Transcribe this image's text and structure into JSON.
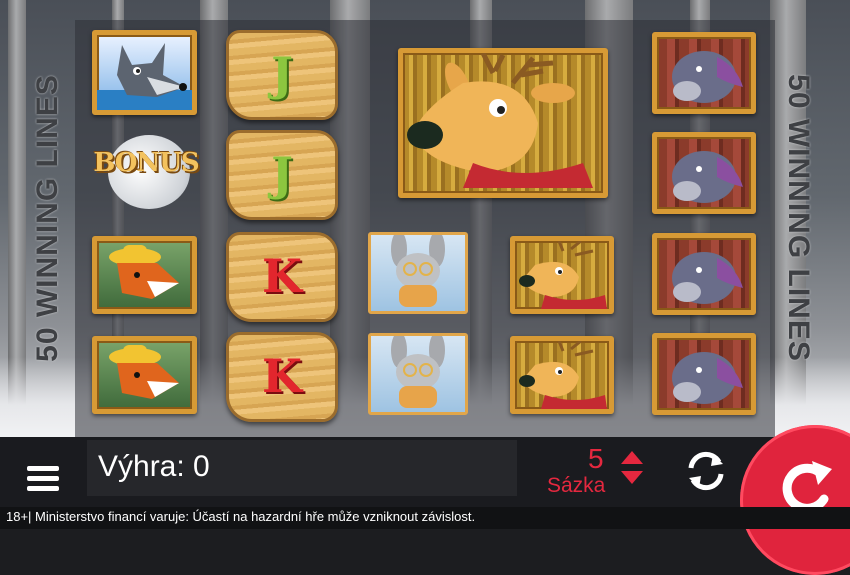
{
  "game": {
    "side_text_left": "50 WINNING LINES",
    "side_text_right": "50 WINNING LINES",
    "reels": [
      [
        "wolf",
        "bonus",
        "fox",
        "fox"
      ],
      [
        "J",
        "J",
        "K",
        "K"
      ],
      [
        "big-deer",
        "big-deer",
        "rabbit",
        "rabbit"
      ],
      [
        "big-deer",
        "big-deer",
        "deer",
        "deer"
      ],
      [
        "boar",
        "boar",
        "boar",
        "boar"
      ]
    ],
    "bonus_label": "BONUS",
    "letter_j": "J",
    "letter_k": "K"
  },
  "controls": {
    "win_label": "Výhra: 0",
    "bet_value": "5",
    "bet_label": "Sázka"
  },
  "footer": {
    "disclaimer": "18+| Ministerstvo financí varuje: Účastí na hazardní hře může vzniknout závislost."
  },
  "colors": {
    "accent": "#e0243d",
    "frame": "#d79a35",
    "j_green": "#8cc63f",
    "k_red": "#e2262d"
  }
}
